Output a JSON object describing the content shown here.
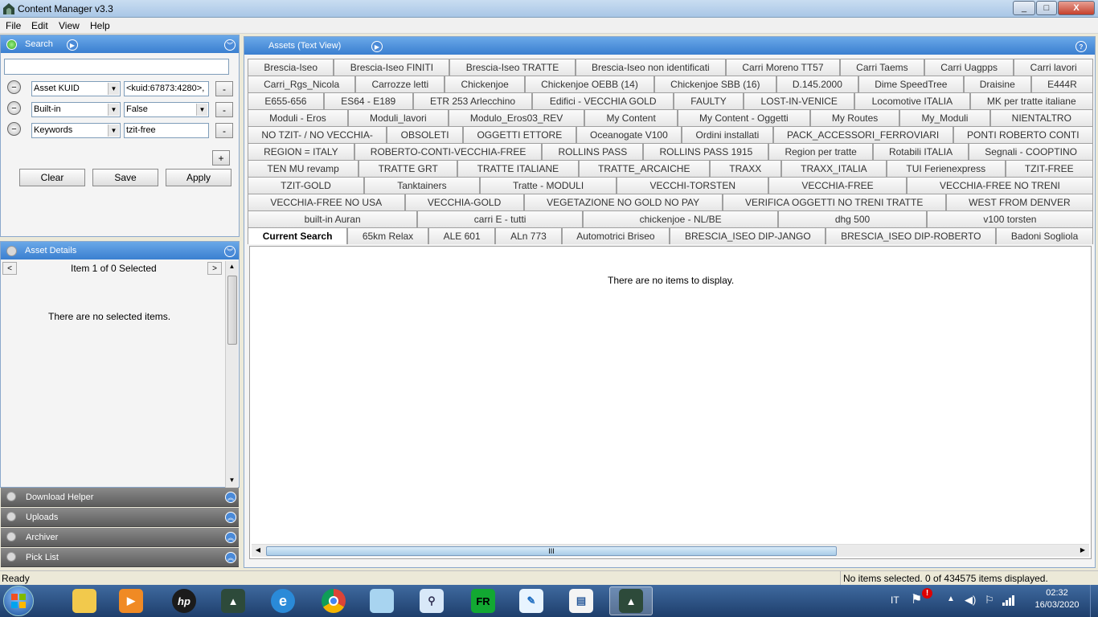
{
  "window": {
    "title": "Content Manager v3.3",
    "minimize": "_",
    "maximize": "□",
    "close": "X"
  },
  "menu": [
    "File",
    "Edit",
    "View",
    "Help"
  ],
  "search_panel": {
    "title": "Search",
    "query": "",
    "filters": [
      {
        "field": "Asset KUID",
        "value": "<kuid:67873:4280>,",
        "value_is_select": false
      },
      {
        "field": "Built-in",
        "value": "False",
        "value_is_select": true
      },
      {
        "field": "Keywords",
        "value": "tzit-free",
        "value_is_select": false
      }
    ],
    "remove_label": "-",
    "add_label": "+",
    "buttons": {
      "clear": "Clear",
      "save": "Save",
      "apply": "Apply"
    }
  },
  "asset_details": {
    "title": "Asset Details",
    "nav_prev": "<",
    "nav_next": ">",
    "selection": "Item 1 of 0 Selected",
    "empty": "There are no selected items."
  },
  "collapsed_panels": [
    "Download Helper",
    "Uploads",
    "Archiver",
    "Pick List"
  ],
  "assets": {
    "title": "Assets (Text View)",
    "help": "?",
    "empty": "There are no items to display.",
    "tab_rows": [
      [
        "Brescia-Iseo",
        "Brescia-Iseo FINITI",
        "Brescia-Iseo TRATTE",
        "Brescia-Iseo non identificati",
        "Carri Moreno TT57",
        "Carri Taems",
        "Carri Uagpps",
        "Carri lavori"
      ],
      [
        "Carri_Rgs_Nicola",
        "Carrozze letti",
        "Chickenjoe",
        "Chickenjoe OEBB (14)",
        "Chickenjoe SBB (16)",
        "D.145.2000",
        "Dime SpeedTree",
        "Draisine",
        "E444R"
      ],
      [
        "E655-656",
        "ES64 - E189",
        "ETR 253 Arlecchino",
        "Edifici - VECCHIA GOLD",
        "FAULTY",
        "LOST-IN-VENICE",
        "Locomotive ITALIA",
        "MK per tratte italiane"
      ],
      [
        "Moduli - Eros",
        "Moduli_lavori",
        "Modulo_Eros03_REV",
        "My Content",
        "My Content - Oggetti",
        "My Routes",
        "My_Moduli",
        "NIENTALTRO"
      ],
      [
        "NO TZIT- / NO VECCHIA-",
        "OBSOLETI",
        "OGGETTI ETTORE",
        "Oceanogate V100",
        "Ordini installati",
        "PACK_ACCESSORI_FERROVIARI",
        "PONTI ROBERTO CONTI"
      ],
      [
        "REGION = ITALY",
        "ROBERTO-CONTI-VECCHIA-FREE",
        "ROLLINS PASS",
        "ROLLINS PASS 1915",
        "Region per tratte",
        "Rotabili ITALIA",
        "Segnali - COOPTINO"
      ],
      [
        "TEN MU revamp",
        "TRATTE GRT",
        "TRATTE ITALIANE",
        "TRATTE_ARCAICHE",
        "TRAXX",
        "TRAXX_ITALIA",
        "TUI Ferienexpress",
        "TZIT-FREE"
      ],
      [
        "TZIT-GOLD",
        "Tanktainers",
        "Tratte - MODULI",
        "VECCHI-TORSTEN",
        "VECCHIA-FREE",
        "VECCHIA-FREE NO TRENI"
      ],
      [
        "VECCHIA-FREE NO USA",
        "VECCHIA-GOLD",
        "VEGETAZIONE NO GOLD NO PAY",
        "VERIFICA OGGETTI NO TRENI TRATTE",
        "WEST FROM DENVER"
      ],
      [
        "built-in Auran",
        "carri E - tutti",
        "chickenjoe - NL/BE",
        "dhg 500",
        "v100 torsten"
      ],
      [
        "Current Search",
        "65km Relax",
        "ALE 601",
        "ALn 773",
        "Automotrici Briseo",
        "BRESCIA_ISEO DIP-JANGO",
        "BRESCIA_ISEO DIP-ROBERTO",
        "Badoni Sogliola"
      ]
    ],
    "active_tab": "Current Search",
    "scroll_grip": "III"
  },
  "status": {
    "left": "Ready",
    "right": "No items selected. 0 of 434575 items displayed."
  },
  "taskbar": {
    "language": "IT",
    "time": "02:32",
    "date": "16/03/2020",
    "apps": [
      "windows-explorer",
      "media-player",
      "hp-support",
      "content-manager",
      "internet-explorer",
      "chrome",
      "notepad",
      "search-tool",
      "fr-app",
      "quill-app",
      "document-app",
      "content-manager-active"
    ]
  }
}
